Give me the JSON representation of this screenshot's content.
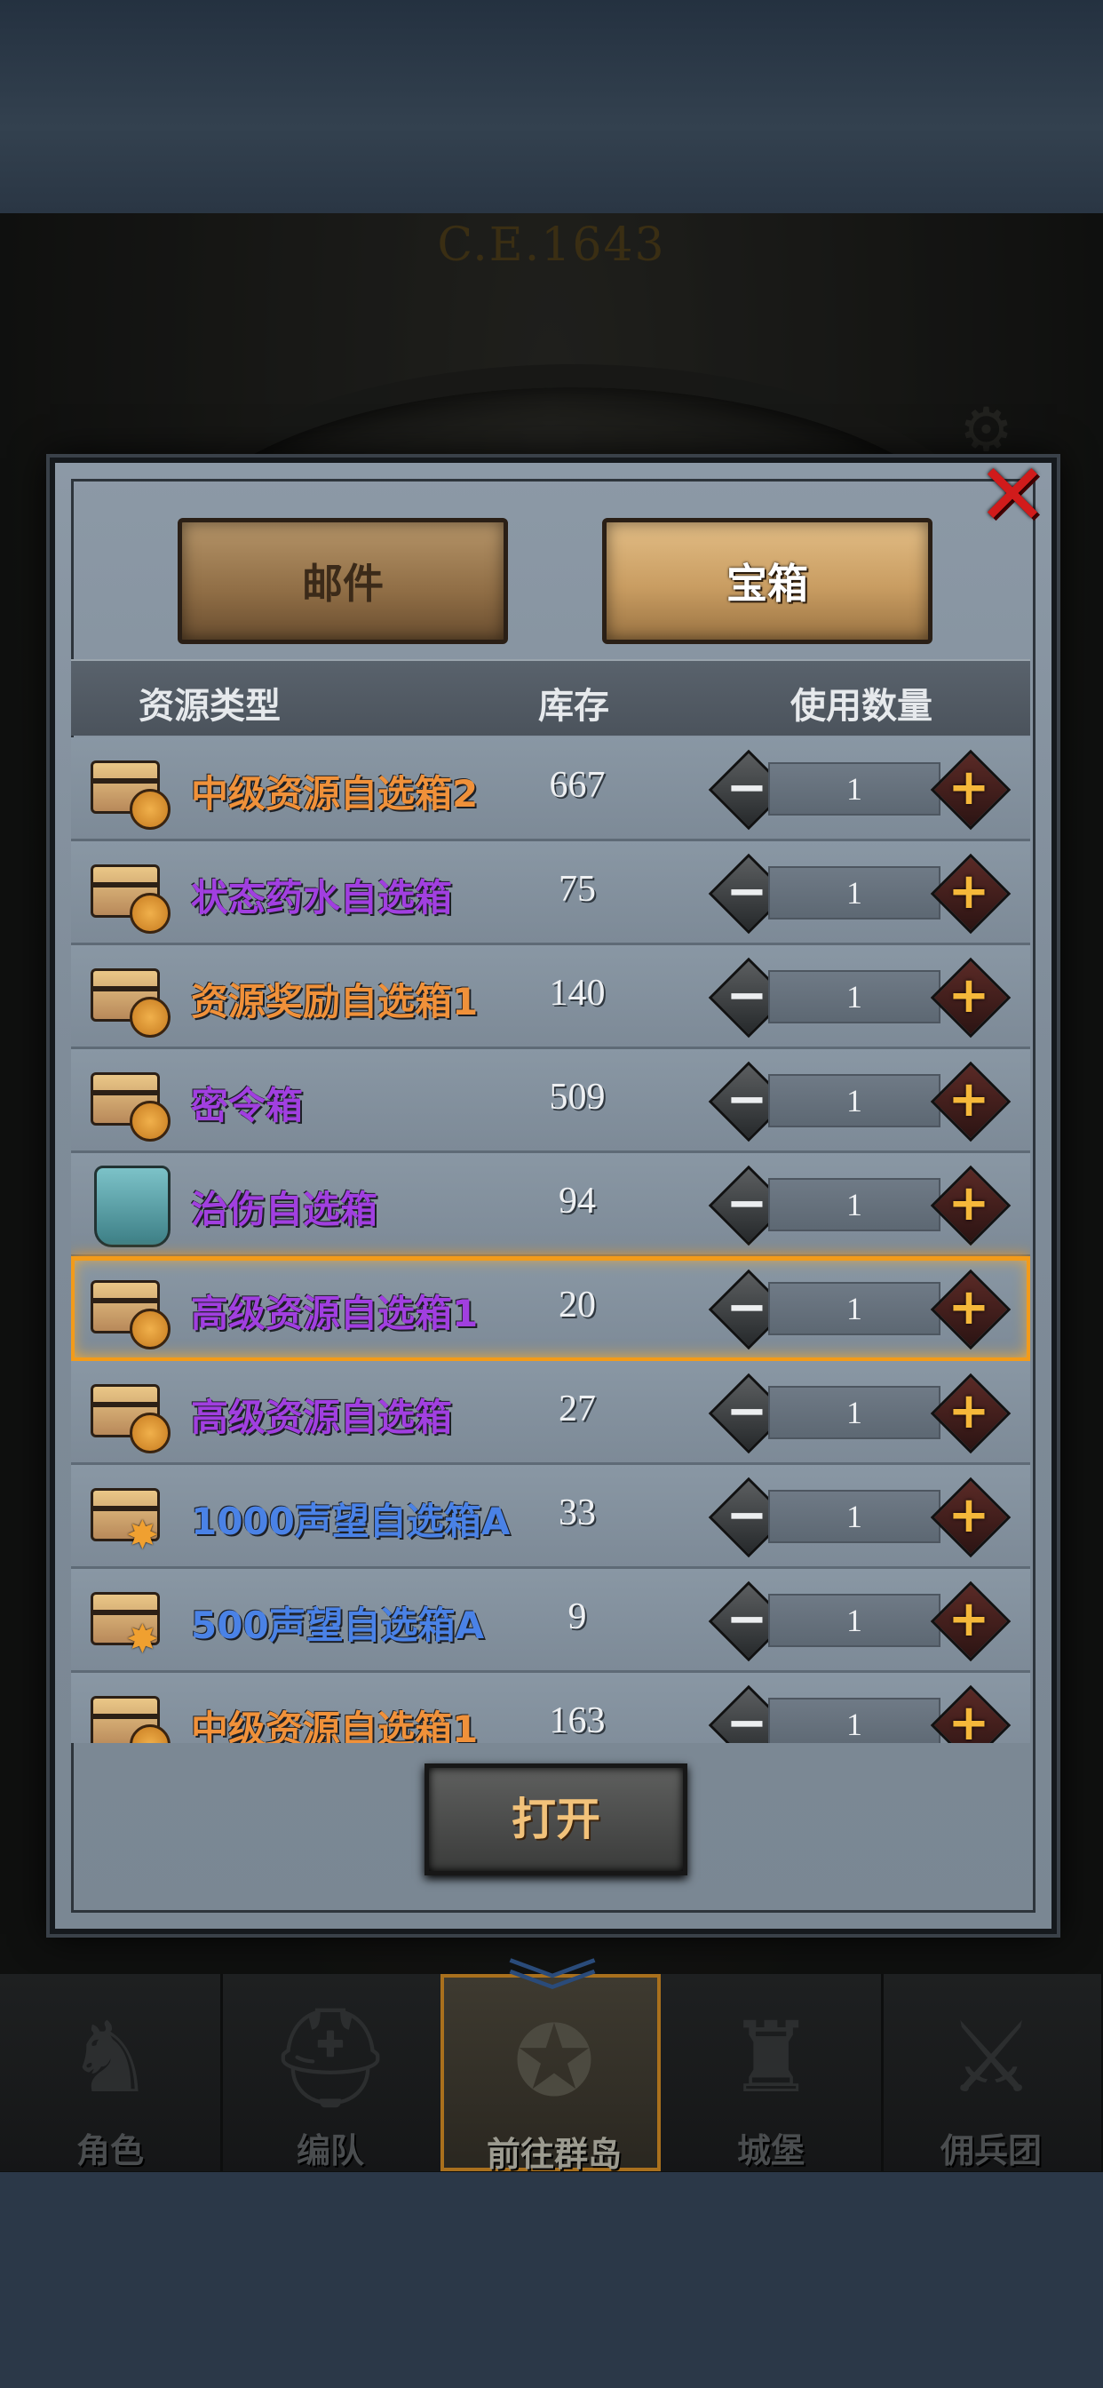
{
  "era": "C.E.1643",
  "close_icon": "close-icon",
  "tabs": [
    {
      "label": "邮件",
      "active": false
    },
    {
      "label": "宝箱",
      "active": true
    }
  ],
  "table_headers": {
    "type": "资源类型",
    "stock": "库存",
    "use_count": "使用数量"
  },
  "rows": [
    {
      "name": "中级资源自选箱2",
      "stock": "667",
      "count": "1",
      "color": "#f0913a",
      "icon": "chest-bag-icon",
      "selected": false
    },
    {
      "name": "状态药水自选箱",
      "stock": "75",
      "count": "1",
      "color": "#a13fe0",
      "icon": "chest-bag-icon",
      "selected": false
    },
    {
      "name": "资源奖励自选箱1",
      "stock": "140",
      "count": "1",
      "color": "#f0913a",
      "icon": "chest-bag-icon",
      "selected": false
    },
    {
      "name": "密令箱",
      "stock": "509",
      "count": "1",
      "color": "#a13fe0",
      "icon": "chest-bag-icon",
      "selected": false
    },
    {
      "name": "治伤自选箱",
      "stock": "94",
      "count": "1",
      "color": "#a13fe0",
      "icon": "potion-icon",
      "selected": false
    },
    {
      "name": "高级资源自选箱1",
      "stock": "20",
      "count": "1",
      "color": "#a13fe0",
      "icon": "chest-bag-icon",
      "selected": true
    },
    {
      "name": "高级资源自选箱",
      "stock": "27",
      "count": "1",
      "color": "#a13fe0",
      "icon": "chest-bag-icon",
      "selected": false
    },
    {
      "name": "1000声望自选箱A",
      "stock": "33",
      "count": "1",
      "color": "#4a82e6",
      "icon": "chest-star-icon",
      "selected": false
    },
    {
      "name": "500声望自选箱A",
      "stock": "9",
      "count": "1",
      "color": "#4a82e6",
      "icon": "chest-star-icon",
      "selected": false
    },
    {
      "name": "中级资源自选箱1",
      "stock": "163",
      "count": "1",
      "color": "#f0913a",
      "icon": "chest-bag-icon",
      "selected": false
    }
  ],
  "open_button": "打开",
  "nav": [
    {
      "label": "角色",
      "icon": "knight-icon"
    },
    {
      "label": "编队",
      "icon": "helmet-icon"
    },
    {
      "label": "前往群岛",
      "icon": "compass-icon",
      "active": true
    },
    {
      "label": "城堡",
      "icon": "castle-icon"
    },
    {
      "label": "佣兵团",
      "icon": "warrior-icon"
    }
  ]
}
